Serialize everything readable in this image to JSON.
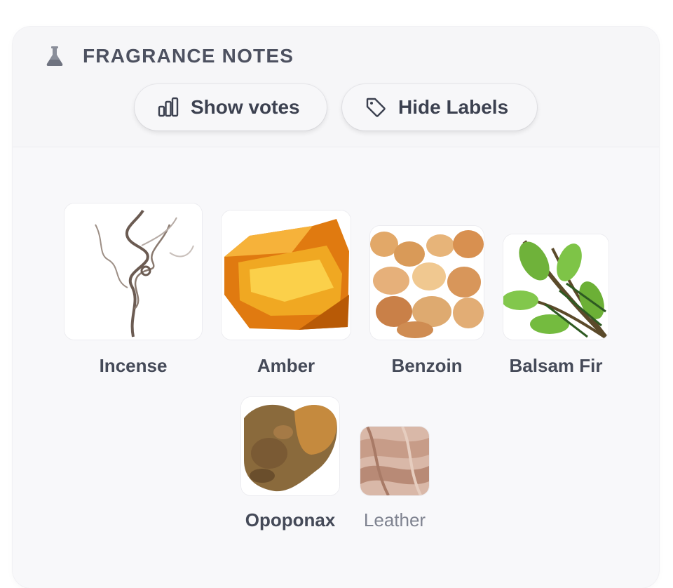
{
  "section": {
    "title": "FRAGRANCE NOTES",
    "icon": "flask-icon"
  },
  "toolbar": {
    "show_votes_label": "Show votes",
    "show_votes_icon": "bar-chart-icon",
    "hide_labels_label": "Hide Labels",
    "hide_labels_icon": "tag-icon"
  },
  "notes": [
    {
      "name": "Incense",
      "image": "incense-smoke"
    },
    {
      "name": "Amber",
      "image": "amber-resin"
    },
    {
      "name": "Benzoin",
      "image": "benzoin-resin"
    },
    {
      "name": "Balsam Fir",
      "image": "fir-branch"
    },
    {
      "name": "Opoponax",
      "image": "opoponax-resin"
    },
    {
      "name": "Leather",
      "image": "leather-fabric"
    }
  ],
  "colors": {
    "text": "#454a58",
    "muted": "#7f8390",
    "card": "#f8f8fa"
  }
}
